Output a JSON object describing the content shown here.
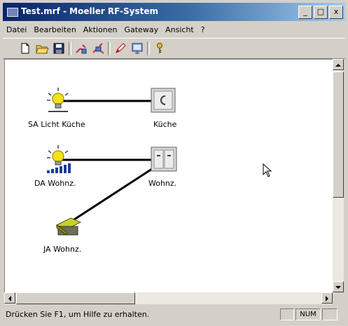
{
  "window": {
    "title": "Test.mrf - Moeller RF-System",
    "controls": {
      "minimize": "_",
      "maximize": "□",
      "close": "x"
    }
  },
  "menu": {
    "items": [
      {
        "label": "Datei"
      },
      {
        "label": "Bearbeiten"
      },
      {
        "label": "Aktionen"
      },
      {
        "label": "Gateway"
      },
      {
        "label": "Ansicht"
      },
      {
        "label": "?"
      }
    ]
  },
  "toolbar": {
    "buttons": [
      {
        "icon": "new-document-icon"
      },
      {
        "icon": "open-folder-icon"
      },
      {
        "icon": "save-disk-icon"
      },
      {
        "icon": "device-connect-icon"
      },
      {
        "icon": "device-disconnect-icon"
      },
      {
        "icon": "pencil-icon"
      },
      {
        "icon": "monitor-icon"
      },
      {
        "icon": "key-icon"
      }
    ]
  },
  "canvas": {
    "devices": [
      {
        "label": "SA Licht Küche",
        "icon": "light-bulb-icon"
      },
      {
        "label": "Küche",
        "icon": "switch-actuator-icon"
      },
      {
        "label": "DA Wohnz.",
        "icon": "dimmer-light-icon"
      },
      {
        "label": "Wohnz.",
        "icon": "double-switch-icon"
      },
      {
        "label": "JA Wohnz.",
        "icon": "blind-actuator-icon"
      }
    ]
  },
  "statusbar": {
    "text": "Drücken Sie F1, um Hilfe zu erhalten.",
    "num": "NUM"
  },
  "colors": {
    "titlebar_start": "#0a246a",
    "titlebar_end": "#a6caf0",
    "face": "#d4d0c8",
    "canvas": "#ffffff",
    "bulb": "#f7e11a",
    "dimmer_bars": "#1c3a9a",
    "blind": "#c8d22a"
  }
}
